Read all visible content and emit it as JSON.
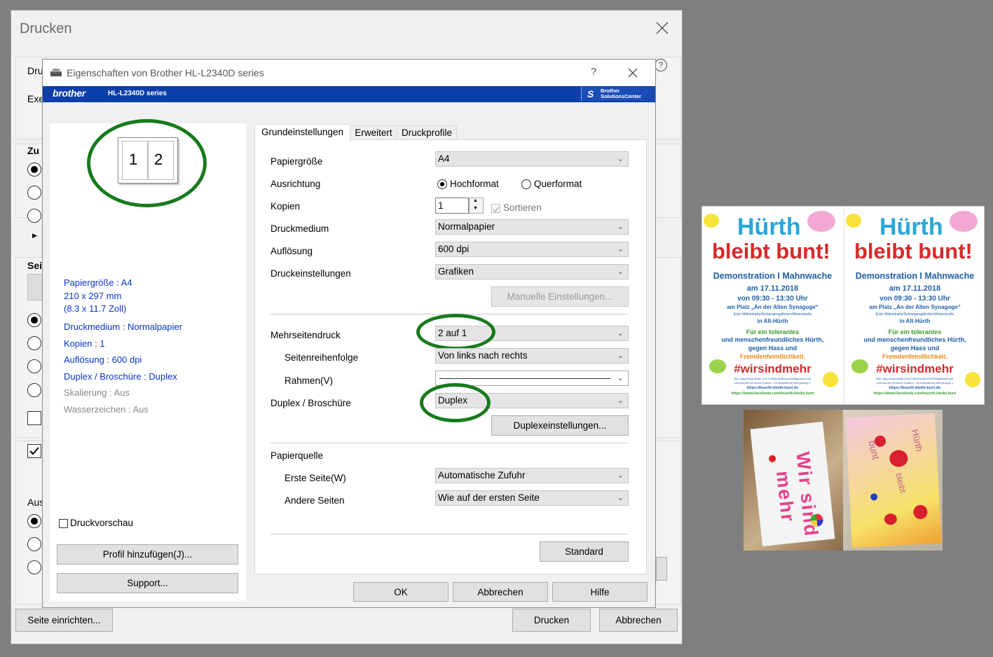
{
  "outer": {
    "title": "Drucken",
    "frag_druc": "Dru",
    "frag_exe": "Exe",
    "frag_zu": "Zu",
    "frag_seit": "Seit",
    "frag_aus": "Aus",
    "setup_button": "Seite einrichten...",
    "print_button": "Drucken",
    "cancel_button": "Abbrechen"
  },
  "dialog": {
    "title": "Eigenschaften von Brother HL-L2340D series",
    "help_glyph": "?",
    "brand": "brother",
    "model": "HL-L2340D series",
    "solutions_line1": "Brother",
    "solutions_line2": "SolutionsCenter",
    "preview_pages": [
      "1",
      "2"
    ],
    "summary": {
      "paper_size": "Papiergröße : A4",
      "dims_mm": "210 x 297 mm",
      "dims_inch": "(8.3 x 11.7 Zoll)",
      "media": "Druckmedium : Normalpapier",
      "copies": "Kopien : 1",
      "resolution": "Auflösung : 600 dpi",
      "duplex": "Duplex / Broschüre : Duplex",
      "scaling": "Skalierung : Aus",
      "watermark": "Wasserzeichen : Aus"
    },
    "preview_checkbox": "Druckvorschau",
    "add_profile_button": "Profil hinzufügen(J)...",
    "support_button": "Support...",
    "tabs": [
      "Grundeinstellungen",
      "Erweitert",
      "Druckprofile"
    ],
    "fields": {
      "paper_size_label": "Papiergröße",
      "paper_size_value": "A4",
      "orientation_label": "Ausrichtung",
      "portrait": "Hochformat",
      "landscape": "Querformat",
      "copies_label": "Kopien",
      "copies_value": "1",
      "collate": "Sortieren",
      "media_label": "Druckmedium",
      "media_value": "Normalpapier",
      "resolution_label": "Auflösung",
      "resolution_value": "600 dpi",
      "settings_label": "Druckeinstellungen",
      "settings_value": "Grafiken",
      "manual_button": "Manuelle Einstellungen...",
      "multipage_label": "Mehrseitendruck",
      "multipage_value": "2 auf 1",
      "order_label": "Seitenreihenfolge",
      "order_value": "Von links nach rechts",
      "border_label": "Rahmen(V)",
      "duplex_label": "Duplex / Broschüre",
      "duplex_value": "Duplex",
      "duplex_settings_button": "Duplexeinstellungen...",
      "source_label": "Papierquelle",
      "first_page_label": "Erste Seite(W)",
      "first_page_value": "Automatische Zufuhr",
      "other_pages_label": "Andere Seiten",
      "other_pages_value": "Wie auf der ersten Seite",
      "standard_button": "Standard"
    },
    "ok_button": "OK",
    "cancel_button": "Abbrechen",
    "help_button": "Hilfe"
  },
  "flyer": {
    "title1": "Hürth",
    "title2": "bleibt bunt!",
    "event": "Demonstration I Mahnwache",
    "date": "am 17.11.2018",
    "time": "von 09:30 - 13:30 Uhr",
    "place": "am Platz „An der Alten Synagoge“",
    "street": "Ecke Mittelstraße/Schlangengäßchen/Weierstraße",
    "district": "in Alt-Hürth",
    "line1": "Für ein tolerantes",
    "line2": "und menschenfreundliches Hürth,",
    "line3": "gegen Hass und",
    "line4": "Fremdenfeindlichkeit.",
    "hashtag": "#wirsindmehr",
    "small1": "Wer mag bringt etwas zum Frühstück/Brunch/Mittagessen mit!",
    "small2": "Und kommt mit euren Kindern - für Malmaterial wird gesorgt :)",
    "url1": "https://huerth-bleibt-bunt.de",
    "url2": "https://www.facebook.com/huerth.bleibt.bunt"
  },
  "drawings": {
    "left_text": "Wir sind mehr",
    "right_text1": "Hürth",
    "right_text2": "bleibt",
    "right_text3": "bunt"
  },
  "colors": {
    "brother_blue": "#0b3ea8",
    "highlight_green": "#177a1c",
    "summary_blue": "#0a35c8"
  }
}
